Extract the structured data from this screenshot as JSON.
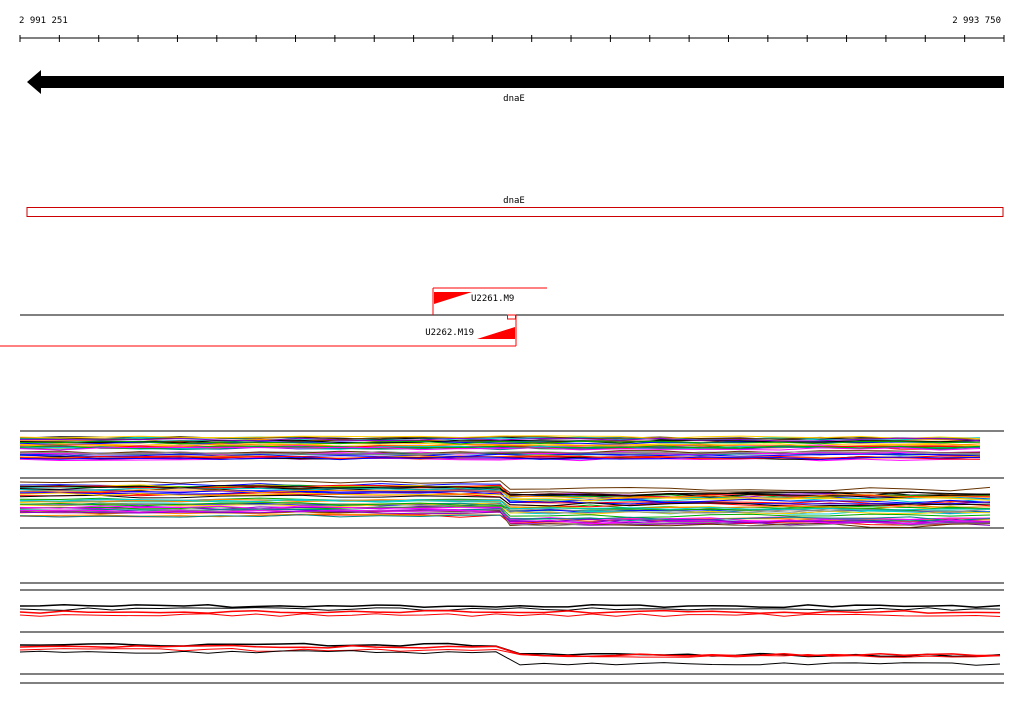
{
  "ruler": {
    "start_label": "2 991 251",
    "end_label": "2 993 750",
    "start": 2991251,
    "end": 2993750,
    "tick_count": 26
  },
  "gene": {
    "label": "dnaE",
    "strand": "reverse",
    "color": "#000000"
  },
  "cds": {
    "label": "dnaE",
    "color": "#cc0000"
  },
  "primers": [
    {
      "label": "U2261.M9",
      "strand": "forward",
      "color": "#ff0000"
    },
    {
      "label": "U2262.M19",
      "strand": "reverse",
      "color": "#ff0000"
    }
  ],
  "tracks": {
    "colors": [
      "#ff0000",
      "#00aa00",
      "#0000ff",
      "#ff00ff",
      "#00cccc",
      "#ffcc00",
      "#000000",
      "#8800cc",
      "#ff8800",
      "#008888",
      "#663300",
      "#888888"
    ],
    "profile_color": "#ff0000",
    "profile_outline": "#000000"
  }
}
